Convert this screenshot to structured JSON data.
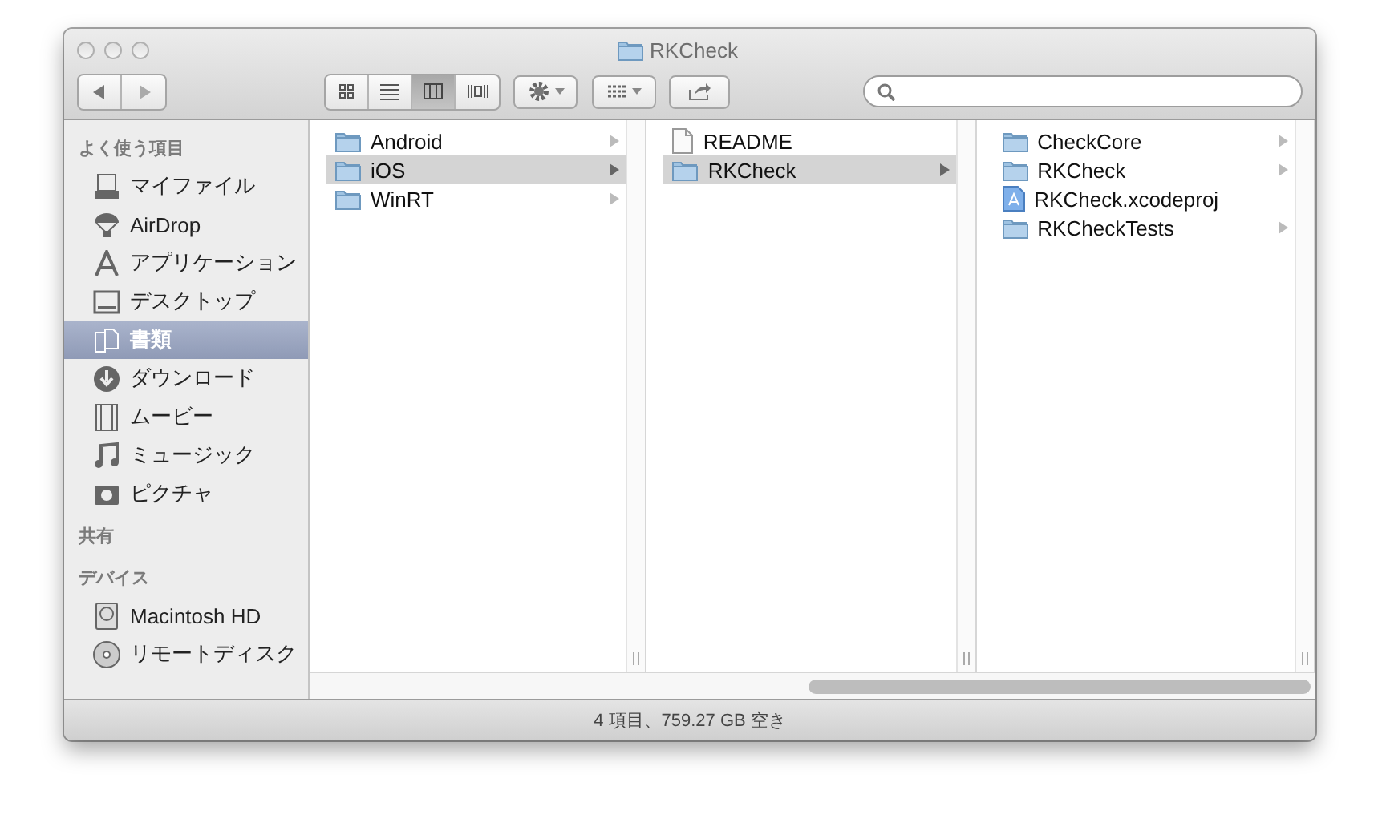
{
  "window": {
    "title": "RKCheck"
  },
  "toolbar": {
    "view_buttons": [
      {
        "kind": "icons",
        "selected": false
      },
      {
        "kind": "list",
        "selected": false
      },
      {
        "kind": "columns",
        "selected": true
      },
      {
        "kind": "coverflow",
        "selected": false
      }
    ]
  },
  "sidebar": {
    "sections": [
      {
        "title": "よく使う項目",
        "items": [
          {
            "label": "マイファイル",
            "kind": "allfiles",
            "selected": false
          },
          {
            "label": "AirDrop",
            "kind": "airdrop",
            "selected": false
          },
          {
            "label": "アプリケーション",
            "kind": "apps",
            "selected": false
          },
          {
            "label": "デスクトップ",
            "kind": "desktop",
            "selected": false
          },
          {
            "label": "書類",
            "kind": "documents",
            "selected": true
          },
          {
            "label": "ダウンロード",
            "kind": "download",
            "selected": false
          },
          {
            "label": "ムービー",
            "kind": "movie",
            "selected": false
          },
          {
            "label": "ミュージック",
            "kind": "music",
            "selected": false
          },
          {
            "label": "ピクチャ",
            "kind": "camera",
            "selected": false
          }
        ]
      },
      {
        "title": "共有"
      },
      {
        "title": "デバイス",
        "items": [
          {
            "label": "Macintosh HD",
            "kind": "disk",
            "selected": false
          },
          {
            "label": "リモートディスク",
            "kind": "cd",
            "selected": false
          }
        ]
      }
    ]
  },
  "columns": [
    {
      "items": [
        {
          "name": "Android",
          "kind": "folder",
          "selected": false,
          "expandable": true
        },
        {
          "name": "iOS",
          "kind": "folder",
          "selected": true,
          "expandable": true
        },
        {
          "name": "WinRT",
          "kind": "folder",
          "selected": false,
          "expandable": true
        }
      ]
    },
    {
      "items": [
        {
          "name": "README",
          "kind": "file",
          "selected": false,
          "expandable": false
        },
        {
          "name": "RKCheck",
          "kind": "folder",
          "selected": true,
          "expandable": true
        }
      ]
    },
    {
      "items": [
        {
          "name": "CheckCore",
          "kind": "folder",
          "selected": false,
          "expandable": true
        },
        {
          "name": "RKCheck",
          "kind": "folder",
          "selected": false,
          "expandable": true
        },
        {
          "name": "RKCheck.xcodeproj",
          "kind": "xcodeproj",
          "selected": false,
          "expandable": false
        },
        {
          "name": "RKCheckTests",
          "kind": "folder",
          "selected": false,
          "expandable": true
        }
      ]
    }
  ],
  "status_bar": "4 項目、759.27 GB 空き"
}
